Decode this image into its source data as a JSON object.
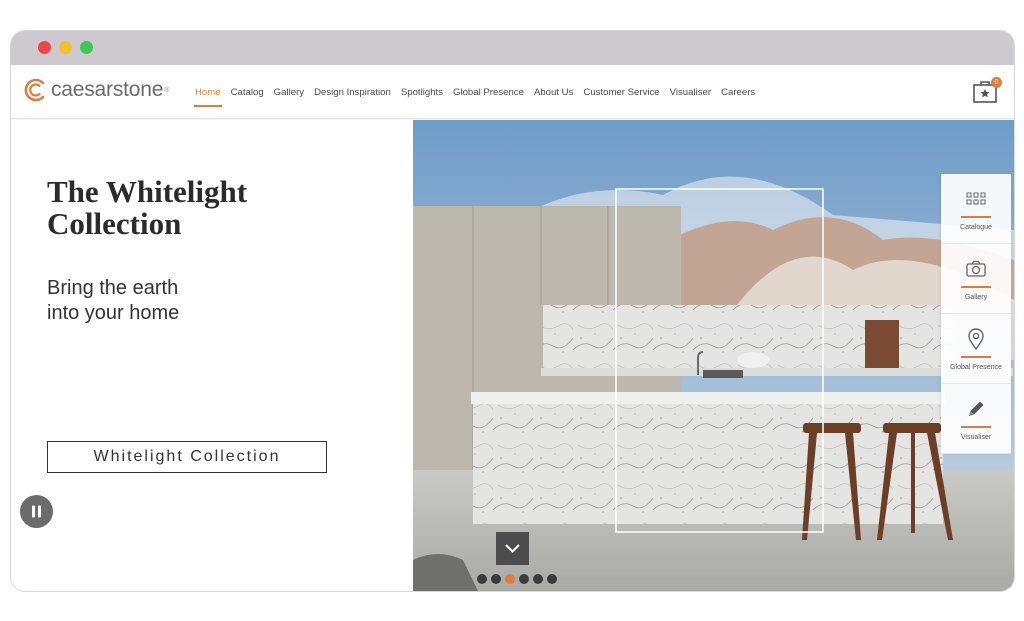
{
  "brand": {
    "name": "caesarstone",
    "registered": "®",
    "accent": "#e07b39"
  },
  "nav": {
    "items": [
      {
        "label": "Home",
        "active": true
      },
      {
        "label": "Catalog"
      },
      {
        "label": "Gallery"
      },
      {
        "label": "Design Inspiration"
      },
      {
        "label": "Spotlights"
      },
      {
        "label": "Global Presence"
      },
      {
        "label": "About Us"
      },
      {
        "label": "Customer Service"
      },
      {
        "label": "Visualiser"
      },
      {
        "label": "Careers"
      }
    ]
  },
  "cart": {
    "count": "0",
    "icon": "shopping-bag-star-icon"
  },
  "hero": {
    "title_line1": "The Whitelight",
    "title_line2": "Collection",
    "subtitle_line1": "Bring the earth",
    "subtitle_line2": "into your home",
    "cta_label": "Whitelight Collection"
  },
  "side_panel": {
    "items": [
      {
        "label": "Catalogue",
        "icon": "grid-icon"
      },
      {
        "label": "Gallery",
        "icon": "camera-icon"
      },
      {
        "label": "Global Presence",
        "icon": "map-pin-icon"
      },
      {
        "label": "Visualiser",
        "icon": "pencil-icon"
      }
    ]
  },
  "carousel": {
    "slides": 6,
    "active_index": 2
  },
  "controls": {
    "pause_icon": "pause-icon",
    "scroll_icon": "chevron-down-icon"
  }
}
